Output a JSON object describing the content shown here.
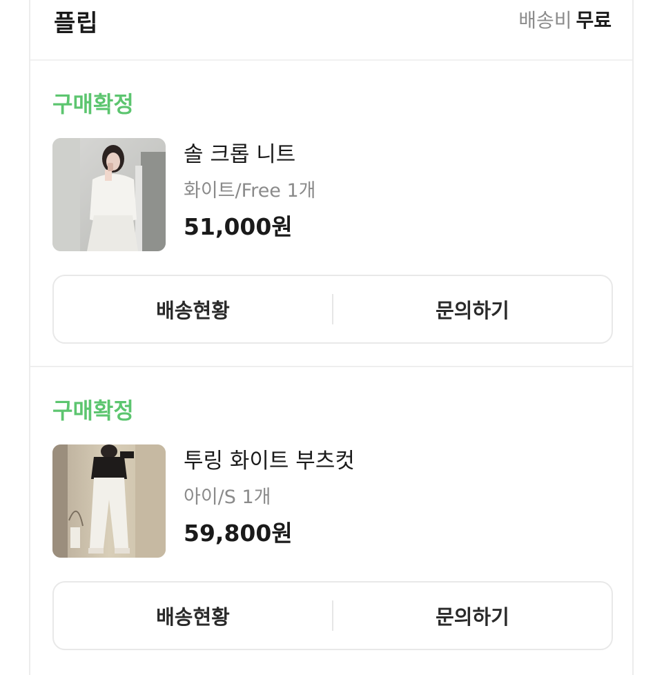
{
  "shop": {
    "name": "플립",
    "shipping_label": "배송비",
    "shipping_value": "무료"
  },
  "accent_color": "#5cc56f",
  "orders": [
    {
      "status": "구매확정",
      "product_name": "솔 크롭 니트",
      "option": "화이트/Free 1개",
      "price": "51,000원",
      "thumbnail": "white-knit-photo",
      "buttons": {
        "shipping_status": "배송현황",
        "inquiry": "문의하기"
      }
    },
    {
      "status": "구매확정",
      "product_name": "투링 화이트 부츠컷",
      "option": "아이/S 1개",
      "price": "59,800원",
      "thumbnail": "white-bootcut-pants-photo",
      "buttons": {
        "shipping_status": "배송현황",
        "inquiry": "문의하기"
      }
    }
  ]
}
